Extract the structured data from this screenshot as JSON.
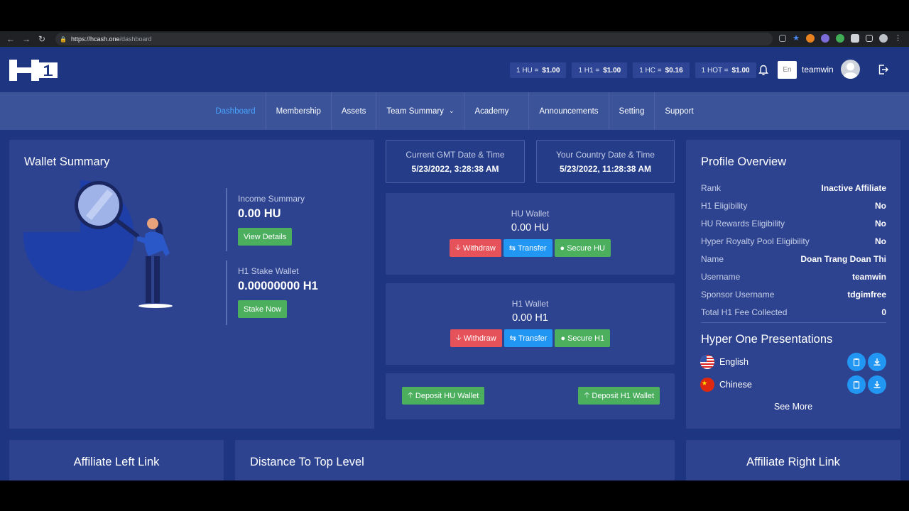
{
  "browser": {
    "url_host": "https://hcash.one",
    "url_path": "/dashboard"
  },
  "header": {
    "rates": [
      {
        "label": "1 HU =",
        "value": "$1.00"
      },
      {
        "label": "1 H1 =",
        "value": "$1.00"
      },
      {
        "label": "1 HC =",
        "value": "$0.16"
      },
      {
        "label": "1 HOT =",
        "value": "$1.00"
      }
    ],
    "language": "En",
    "username": "teamwin"
  },
  "nav": {
    "items": [
      "Dashboard",
      "Membership",
      "Assets",
      "Team Summary",
      "Academy",
      "Announcements",
      "Setting",
      "Support"
    ]
  },
  "wallet_summary": {
    "title": "Wallet Summary",
    "income_label": "Income Summary",
    "income_value": "0.00 HU",
    "view_details": "View Details",
    "stake_label": "H1 Stake Wallet",
    "stake_value": "0.00000000 H1",
    "stake_now": "Stake Now"
  },
  "time": {
    "gmt_label": "Current GMT Date & Time",
    "gmt_value": "5/23/2022, 3:28:38 AM",
    "local_label": "Your Country Date & Time",
    "local_value": "5/23/2022, 11:28:38 AM"
  },
  "hu_wallet": {
    "label": "HU Wallet",
    "value": "0.00 HU",
    "withdraw": "Withdraw",
    "transfer": "Transfer",
    "secure": "Secure HU"
  },
  "h1_wallet": {
    "label": "H1 Wallet",
    "value": "0.00 H1",
    "withdraw": "Withdraw",
    "transfer": "Transfer",
    "secure": "Secure H1"
  },
  "deposit": {
    "hu": "Deposit HU Wallet",
    "h1": "Deposit H1 Wallet"
  },
  "profile": {
    "title": "Profile Overview",
    "rows": [
      {
        "key": "Rank",
        "value": "Inactive Affiliate"
      },
      {
        "key": "H1 Eligibility",
        "value": "No"
      },
      {
        "key": "HU Rewards Eligibility",
        "value": "No"
      },
      {
        "key": "Hyper Royalty Pool Eligibility",
        "value": "No"
      },
      {
        "key": "Name",
        "value": "Doan Trang Doan Thi"
      },
      {
        "key": "Username",
        "value": "teamwin"
      },
      {
        "key": "Sponsor Username",
        "value": "tdgimfree"
      },
      {
        "key": "Total H1 Fee Collected",
        "value": "0"
      }
    ],
    "presentations_title": "Hyper One Presentations",
    "presentations": [
      "English",
      "Chinese"
    ],
    "see_more": "See More"
  },
  "bottom": {
    "left": "Affiliate Left Link",
    "middle": "Distance To Top Level",
    "right": "Affiliate Right Link"
  },
  "colors": {
    "page_bg": "#1e3582",
    "card_bg": "#2d4390",
    "nav_bg": "#3a5399",
    "active": "#4aa3ff",
    "green": "#4caf5e",
    "red": "#e5525a",
    "blue": "#2196f3"
  }
}
